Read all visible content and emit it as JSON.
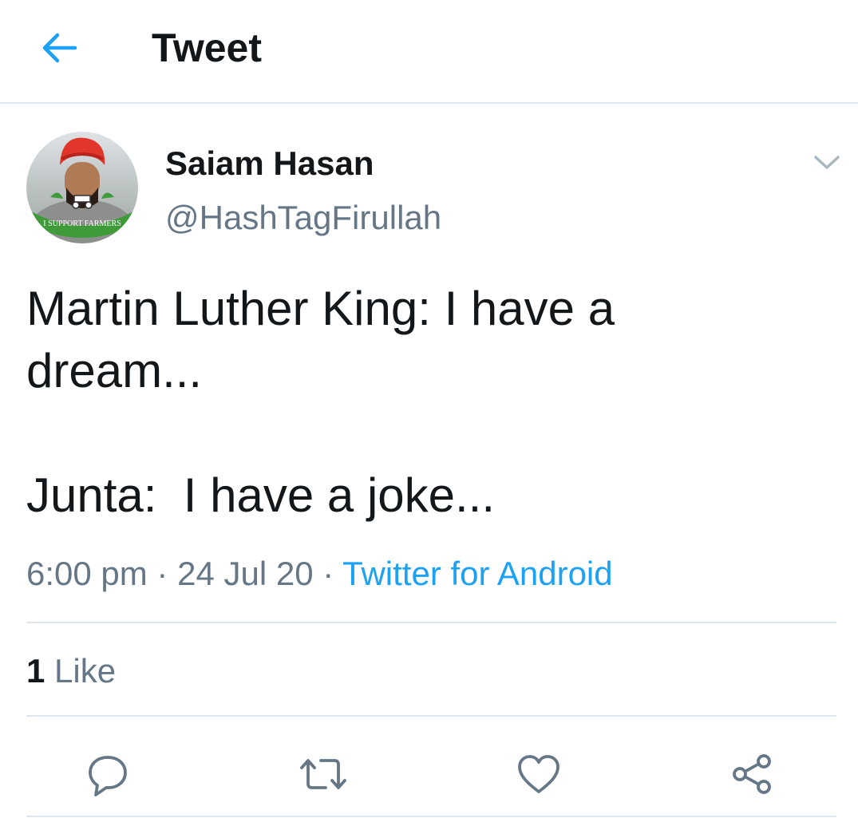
{
  "header": {
    "title": "Tweet",
    "back_icon": "arrow-left-icon"
  },
  "colors": {
    "accent": "#1da1f2",
    "text": "#14171a",
    "secondary": "#657786",
    "divider": "#e1e8ed"
  },
  "tweet": {
    "author": {
      "name": "Saiam Hasan",
      "handle": "@HashTagFirullah",
      "avatar_caption": "I SUPPORT FARMERS"
    },
    "body": {
      "line1": "Martin Luther King: I have a",
      "line2": "dream...",
      "line3": "Junta:  I have a joke..."
    },
    "meta": {
      "time": "6:00 pm",
      "sep1": " · ",
      "date": "24 Jul 20",
      "sep2": " · ",
      "source": "Twitter for Android"
    },
    "likes": {
      "count": "1",
      "label": " Like"
    }
  },
  "actions": [
    {
      "name": "reply",
      "icon": "reply-icon"
    },
    {
      "name": "retweet",
      "icon": "retweet-icon"
    },
    {
      "name": "like",
      "icon": "heart-icon"
    },
    {
      "name": "share",
      "icon": "share-icon"
    }
  ]
}
